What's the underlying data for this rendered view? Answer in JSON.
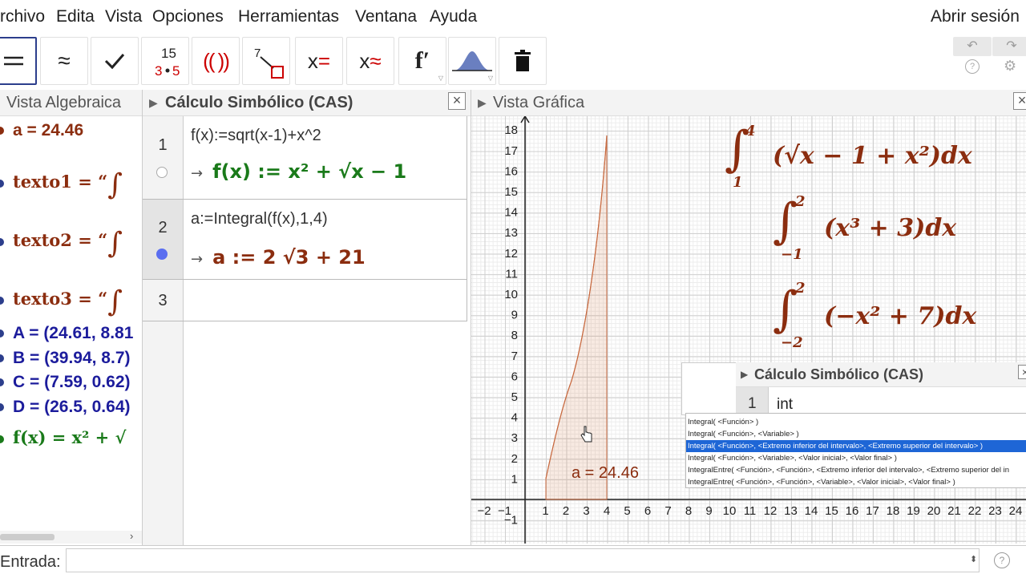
{
  "menu": [
    "rchivo",
    "Edita",
    "Vista",
    "Opciones",
    "Herramientas",
    "Ventana",
    "Ayuda"
  ],
  "login": "Abrir sesión",
  "toolbar": {
    "undo_icon": "undo-icon",
    "redo_icon": "redo-icon",
    "help_icon": "?",
    "settings_icon": "⚙"
  },
  "algebra": {
    "title": "Vista Algebraica",
    "rows": [
      {
        "text": "a = 24.46",
        "color": "#8b2d0f"
      },
      {
        "text": "texto1 = “",
        "color": "#8b2d0f"
      },
      {
        "text": "texto2 = “",
        "color": "#8b2d0f"
      },
      {
        "text": "texto3 = “",
        "color": "#8b2d0f"
      },
      {
        "text": "A = (24.61, 8.81",
        "color": "#1c1c9c"
      },
      {
        "text": "B = (39.94, 8.7)",
        "color": "#1c1c9c"
      },
      {
        "text": "C = (7.59, 0.62)",
        "color": "#1c1c9c"
      },
      {
        "text": "D = (26.5, 0.64)",
        "color": "#1c1c9c"
      },
      {
        "text": "f(x) = x² + √",
        "color": "#1a7a1a"
      }
    ]
  },
  "cas": {
    "title": "Cálculo Simbólico (CAS)",
    "rows": [
      {
        "num": "1",
        "input": "f(x):=sqrt(x-1)+x^2",
        "output": "f(x) := x² + √x − 1",
        "arrow": "→"
      },
      {
        "num": "2",
        "input": "a:=Integral(f(x),1,4)",
        "output": "a := 2 √3 + 21",
        "arrow": "→"
      },
      {
        "num": "3",
        "input": "",
        "output": ""
      }
    ]
  },
  "graphics": {
    "title": "Vista Gráfica",
    "label_a": "a = 24.46",
    "x_ticks": [
      "−2",
      "−1",
      "1",
      "2",
      "3",
      "4",
      "5",
      "6",
      "7",
      "8",
      "9",
      "10",
      "11",
      "12",
      "13",
      "14",
      "15",
      "16",
      "17",
      "18",
      "19",
      "20",
      "21",
      "22",
      "23",
      "24"
    ],
    "y_ticks": [
      "1",
      "2",
      "3",
      "4",
      "5",
      "6",
      "7",
      "8",
      "9",
      "10",
      "11",
      "12",
      "13",
      "14",
      "15",
      "16",
      "17",
      "18"
    ],
    "y_neg": "−1",
    "integrals": [
      {
        "lower": "1",
        "upper": "4",
        "body": "(√x − 1 + x²)dx"
      },
      {
        "lower": "−1",
        "upper": "2",
        "body": "(x³ + 3)dx"
      },
      {
        "lower": "−2",
        "upper": "2",
        "body": "(−x² + 7)dx"
      }
    ]
  },
  "cas_inner": {
    "title": "Cálculo Simbólico (CAS)",
    "row_num": "1",
    "input": "int",
    "suggestions": [
      "Integral( <Función> )",
      "Integral( <Función>, <Variable> )",
      "Integral( <Función>, <Extremo inferior del intervalo>, <Extremo superior del intervalo> )",
      "Integral( <Función>, <Variable>, <Valor inicial>, <Valor final> )",
      "IntegralEntre( <Función>, <Función>, <Extremo inferior del intervalo>, <Extremo superior del in",
      "IntegralEntre( <Función>, <Función>, <Variable>, <Valor inicial>, <Valor final> )"
    ],
    "highlighted_index": 2
  },
  "input_bar": {
    "label": "Entrada:",
    "value": ""
  }
}
